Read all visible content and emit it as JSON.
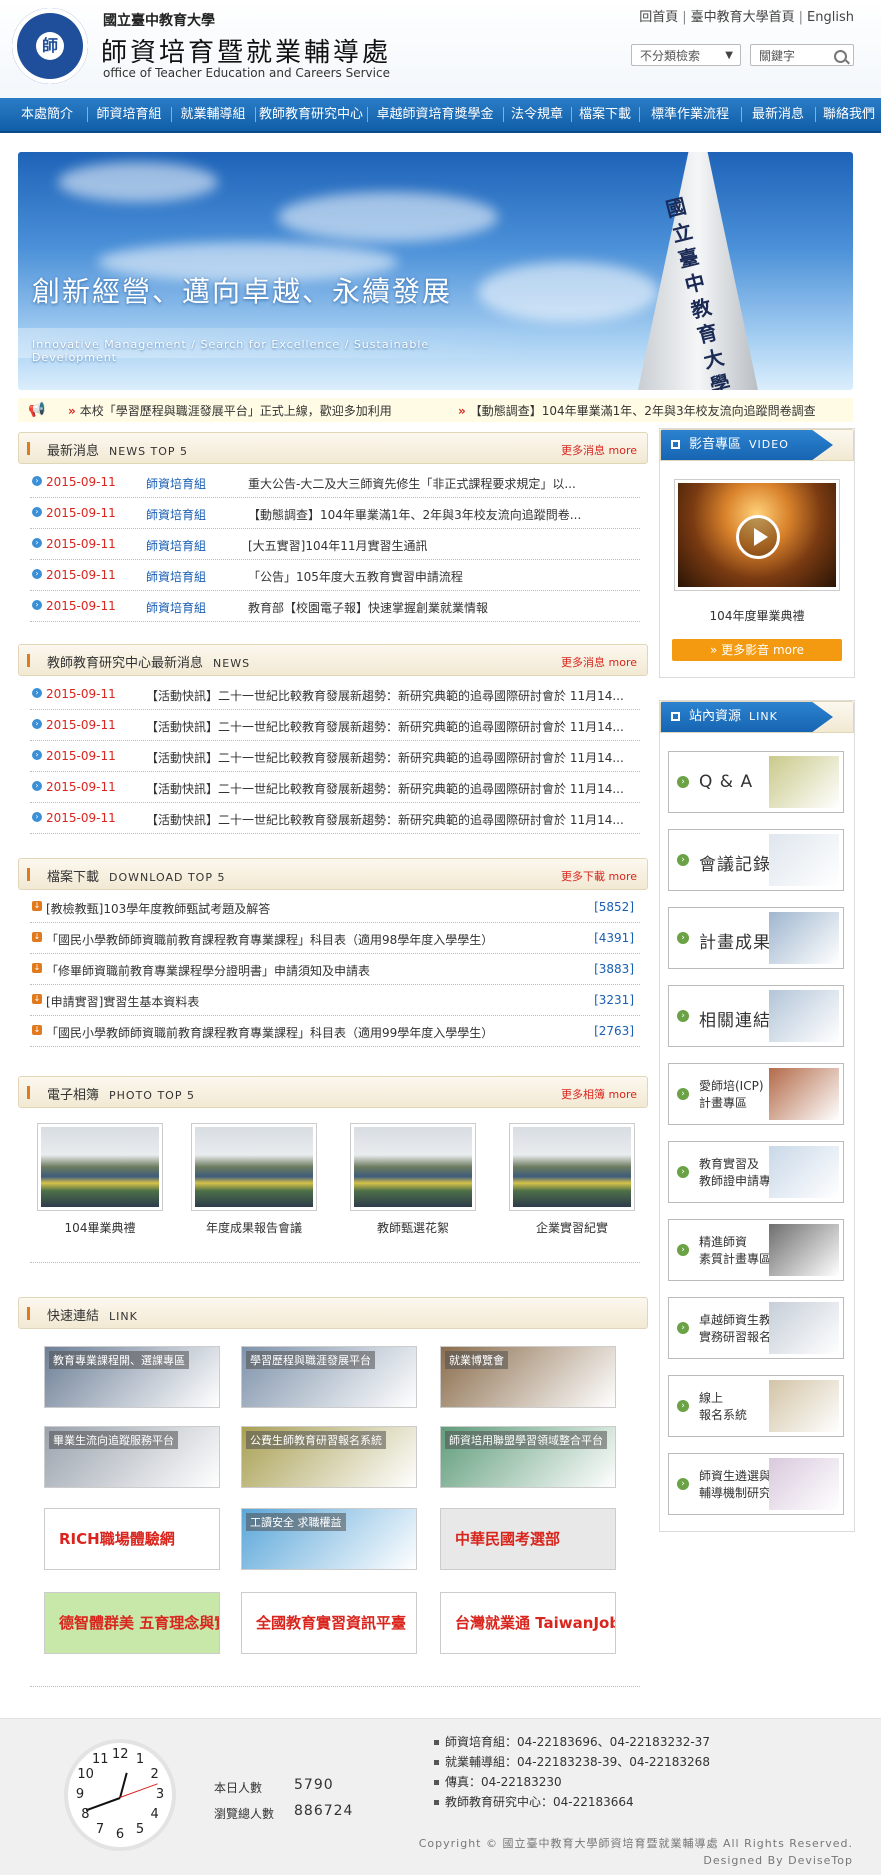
{
  "header": {
    "university": "國立臺中教育大學",
    "dept_zh": "師資培育暨就業輔導處",
    "dept_en": "office of Teacher Education and Careers Service",
    "logo_text": "師",
    "top_links": [
      "回首頁",
      "臺中教育大學首頁",
      "English"
    ],
    "search_category": "不分類檢索",
    "search_placeholder": "關鍵字"
  },
  "nav": [
    "本處簡介",
    "師資培育組",
    "就業輔導組",
    "教師教育研究中心",
    "卓越師資培育獎學金",
    "法令規章",
    "檔案下載",
    "標準作業流程",
    "最新消息",
    "聯絡我們"
  ],
  "banner": {
    "slogan": "創新經營、邁向卓越、永續發展",
    "slogan_en": "Innovative Management / Search for Excellence / Sustainable Development",
    "tower_text": "國立臺中教育大學"
  },
  "ticker": [
    "本校「學習歷程與職涯發展平台」正式上線，歡迎多加利用",
    "【動態調查】104年畢業滿1年、2年與3年校友流向追蹤問卷調查"
  ],
  "news": {
    "title": "最新消息",
    "title_en": "NEWS TOP 5",
    "more": "更多消息 more",
    "items": [
      {
        "date": "2015-09-11",
        "group": "師資培育組",
        "text": "重大公告-大二及大三師資先修生「非正式課程要求規定」以..."
      },
      {
        "date": "2015-09-11",
        "group": "師資培育組",
        "text": "【動態調查】104年畢業滿1年、2年與3年校友流向追蹤問卷..."
      },
      {
        "date": "2015-09-11",
        "group": "師資培育組",
        "text": "[大五實習]104年11月實習生通訊"
      },
      {
        "date": "2015-09-11",
        "group": "師資培育組",
        "text": "「公告」105年度大五教育實習申請流程"
      },
      {
        "date": "2015-09-11",
        "group": "師資培育組",
        "text": "教育部【校園電子報】快速掌握創業就業情報"
      }
    ]
  },
  "research": {
    "title": "教師教育研究中心最新消息",
    "title_en": "NEWS",
    "more": "更多消息 more",
    "items": [
      {
        "date": "2015-09-11",
        "text": "【活動快訊】二十一世紀比較教育發展新趨勢：新研究典範的追尋國際研討會於 11月14..."
      },
      {
        "date": "2015-09-11",
        "text": "【活動快訊】二十一世紀比較教育發展新趨勢：新研究典範的追尋國際研討會於 11月14..."
      },
      {
        "date": "2015-09-11",
        "text": "【活動快訊】二十一世紀比較教育發展新趨勢：新研究典範的追尋國際研討會於 11月14..."
      },
      {
        "date": "2015-09-11",
        "text": "【活動快訊】二十一世紀比較教育發展新趨勢：新研究典範的追尋國際研討會於 11月14..."
      },
      {
        "date": "2015-09-11",
        "text": "【活動快訊】二十一世紀比較教育發展新趨勢：新研究典範的追尋國際研討會於 11月14..."
      }
    ]
  },
  "download": {
    "title": "檔案下載",
    "title_en": "DOWNLOAD TOP 5",
    "more": "更多下載 more",
    "items": [
      {
        "text": "[教檢教甄]103學年度教師甄試考題及解答",
        "count": "[5852]"
      },
      {
        "text": "「國民小學教師師資職前教育課程教育專業課程」科目表（適用98學年度入學學生）",
        "count": "[4391]"
      },
      {
        "text": "「修畢師資職前教育專業課程學分證明書」申請須知及申請表",
        "count": "[3883]"
      },
      {
        "text": "[申請實習]實習生基本資料表",
        "count": "[3231]"
      },
      {
        "text": "「國民小學教師師資職前教育課程教育專業課程」科目表（適用99學年度入學學生）",
        "count": "[2763]"
      }
    ]
  },
  "photos": {
    "title": "電子相簿",
    "title_en": "PHOTO TOP 5",
    "more": "更多相簿 more",
    "items": [
      "104畢業典禮",
      "年度成果報告會議",
      "教師甄選花絮",
      "企業實習紀實"
    ]
  },
  "quicklinks": {
    "title": "快速連結",
    "title_en": "LINK",
    "items": [
      {
        "label": "教育專業課程開、選課專區",
        "color": "#6d7f97"
      },
      {
        "label": "學習歷程與職涯發展平台",
        "color": "#7f93ab"
      },
      {
        "label": "就業博覽會",
        "color": "#8b6d4c"
      },
      {
        "label": "畢業生流向追蹤服務平台",
        "color": "#9aa2ad"
      },
      {
        "label": "公費生師教育研習報名系統",
        "color": "#a9a054"
      },
      {
        "label": "師資培用聯盟學習領域整合平台",
        "color": "#5f9c7a"
      },
      {
        "label": "RICH職場體驗網",
        "color": "#ffffff"
      },
      {
        "label": "工讀安全 求職權益",
        "color": "#5aa6d9"
      },
      {
        "label": "中華民國考選部",
        "color": "#e8e8e8"
      },
      {
        "label": "德智體群美 五育理念與實踐",
        "color": "#c7e8a9"
      },
      {
        "label": "全國教育實習資訊平臺",
        "color": "#ffffff"
      },
      {
        "label": "台灣就業通 TaiwanJobs",
        "color": "#ffffff"
      }
    ]
  },
  "video": {
    "title": "影音專區",
    "title_en": "VIDEO",
    "caption": "104年度畢業典禮",
    "more": "更多影音 more"
  },
  "resources": {
    "title": "站內資源",
    "title_en": "LINK",
    "items": [
      {
        "label": "Q & A",
        "small": false,
        "color": "#c9c98a"
      },
      {
        "label": "會議記錄",
        "small": false,
        "color": "#dfe6ee"
      },
      {
        "label": "計畫成果",
        "small": false,
        "color": "#9fb6cf"
      },
      {
        "label": "相關連結",
        "small": false,
        "color": "#b3c5d8"
      },
      {
        "label": "愛師培(ICP)\n計畫專區",
        "small": true,
        "color": "#b36a49"
      },
      {
        "label": "教育實習及\n教師證申請專區",
        "small": true,
        "color": "#c9d8e8"
      },
      {
        "label": "精進師資\n素質計畫專區",
        "small": true,
        "color": "#6e6e6e"
      },
      {
        "label": "卓越師資生教學\n實務研習報名系統",
        "small": true,
        "color": "#c6ced8"
      },
      {
        "label": "線上\n報名系統",
        "small": true,
        "color": "#d2c3a5"
      },
      {
        "label": "師資生遴選與\n輔導機制研究網站",
        "small": true,
        "color": "#d9c9dd"
      }
    ]
  },
  "footer": {
    "today_label": "本日人數",
    "today": "5790",
    "total_label": "瀏覽總人數",
    "total": "886724",
    "contacts": [
      "師資培育組：04-22183696、04-22183232-37",
      "就業輔導組：04-22183238-39、04-22183268",
      "傳真：04-22183230",
      "教師教育研究中心：04-22183664"
    ],
    "copyright": "Copyright © 國立臺中教育大學師資培育暨就業輔導處 All Rights Reserved.",
    "designed": "Designed By DeviseTop",
    "clock_numbers": [
      "12",
      "1",
      "2",
      "3",
      "4",
      "5",
      "6",
      "7",
      "8",
      "9",
      "10",
      "11"
    ]
  }
}
